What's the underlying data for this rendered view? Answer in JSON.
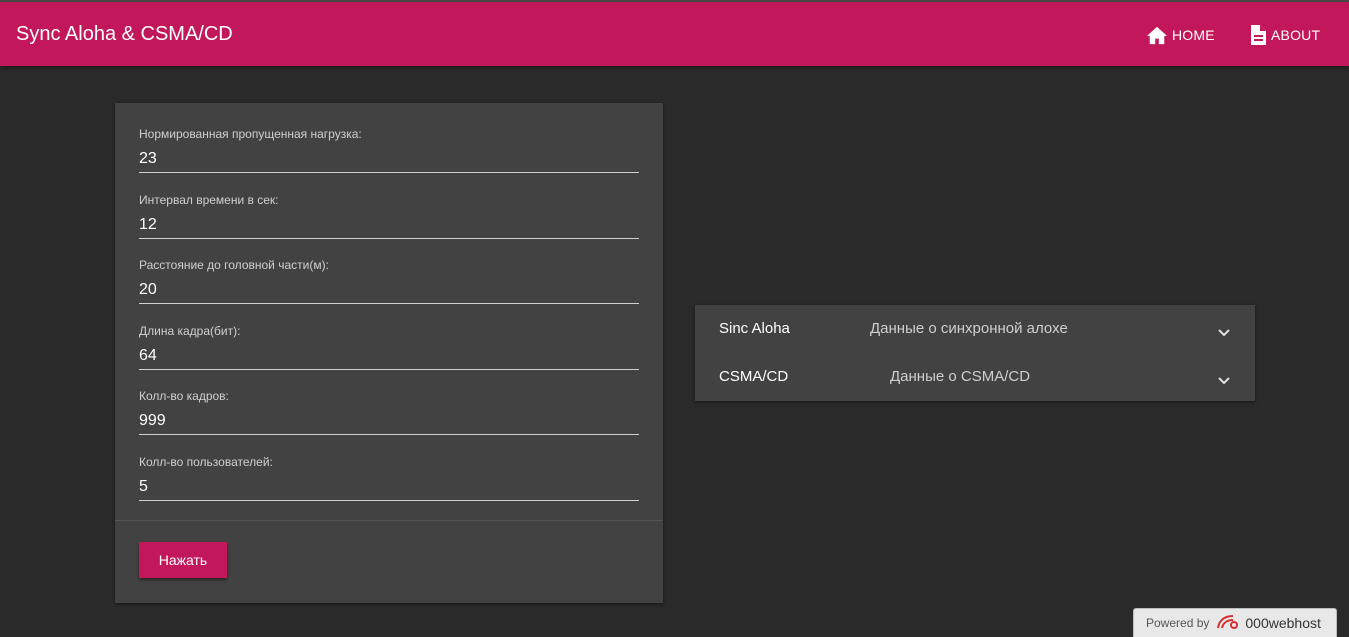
{
  "appbar": {
    "title": "Sync Aloha & CSMA/CD",
    "nav": [
      {
        "label": "HOME",
        "icon": "home-icon"
      },
      {
        "label": "ABOUT",
        "icon": "document-icon"
      }
    ]
  },
  "form": {
    "fields": [
      {
        "label": "Нормированная пропущенная нагрузка:",
        "value": "23"
      },
      {
        "label": "Интервал времени в сек:",
        "value": "12"
      },
      {
        "label": "Расстояние до головной части(м):",
        "value": "20"
      },
      {
        "label": "Длина кадра(бит):",
        "value": "64"
      },
      {
        "label": "Колл-во кадров:",
        "value": "999"
      },
      {
        "label": "Колл-во пользователей:",
        "value": "5"
      }
    ],
    "submit_label": "Нажать"
  },
  "accordion": {
    "items": [
      {
        "title": "Sinc Aloha",
        "description": "Данные о синхронной алохе"
      },
      {
        "title": "CSMA/CD",
        "description": "Данные о CSMA/CD"
      }
    ]
  },
  "footer": {
    "powered_by": "Powered by",
    "host": "000webhost",
    "logo_icon": "000webhost-logo-icon"
  },
  "colors": {
    "accent": "#c2185b",
    "background": "#2a2a2a",
    "surface": "#424242"
  }
}
